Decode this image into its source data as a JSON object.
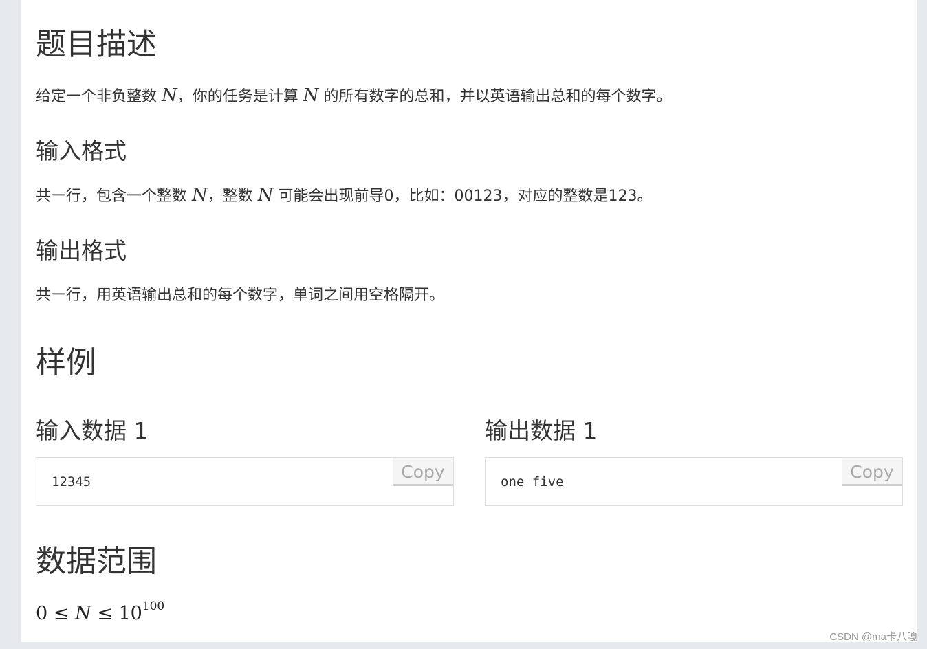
{
  "problem": {
    "description_title": "题目描述",
    "description": {
      "p1": "给定一个非负整数 ",
      "var1": "N",
      "p2": "，你的任务是计算 ",
      "var2": "N",
      "p3": " 的所有数字的总和，并以英语输出总和的每个数字。"
    },
    "input_format_title": "输入格式",
    "input_format": {
      "p1": "共一行，包含一个整数 ",
      "var1": "N",
      "p2": "，整数 ",
      "var2": "N",
      "p3": " 可能会出现前导0，比如：00123，对应的整数是123。"
    },
    "output_format_title": "输出格式",
    "output_format": "共一行，用英语输出总和的每个数字，单词之间用空格隔开。",
    "samples_title": "样例",
    "samples": [
      {
        "title": "输入数据 1",
        "content": "12345",
        "copy_label": "Copy"
      },
      {
        "title": "输出数据 1",
        "content": "one five",
        "copy_label": "Copy"
      }
    ],
    "range_title": "数据范围",
    "range": {
      "zero": "0",
      "le1": "≤",
      "var": "N",
      "le2": "≤",
      "base": "10",
      "exp": "100"
    }
  },
  "watermark": "CSDN @ma卡八嘎"
}
